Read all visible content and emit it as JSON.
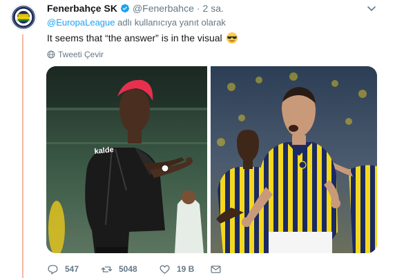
{
  "tweet": {
    "display_name": "Fenerbahçe SK",
    "handle": "@Fenerbahce",
    "separator": "·",
    "time": "2 sa.",
    "reply_mention": "@EuropaLeague",
    "reply_suffix": "adlı kullanıcıya yanıt olarak",
    "text": "It seems that “the answer” is in the visual",
    "translate_label": "Tweeti Çevir"
  },
  "stats": {
    "replies": "547",
    "retweets": "5048",
    "likes": "19 B"
  },
  "icons": {
    "verified": "verified-badge-icon",
    "caret": "chevron-down-icon",
    "emoji": "sunglasses-emoji",
    "globe": "globe-icon",
    "reply": "reply-icon",
    "retweet": "retweet-icon",
    "like": "heart-icon",
    "dm": "envelope-icon"
  },
  "colors": {
    "accent": "#1da1f2",
    "muted": "#657786",
    "thread_line": "#f5b8a1"
  }
}
